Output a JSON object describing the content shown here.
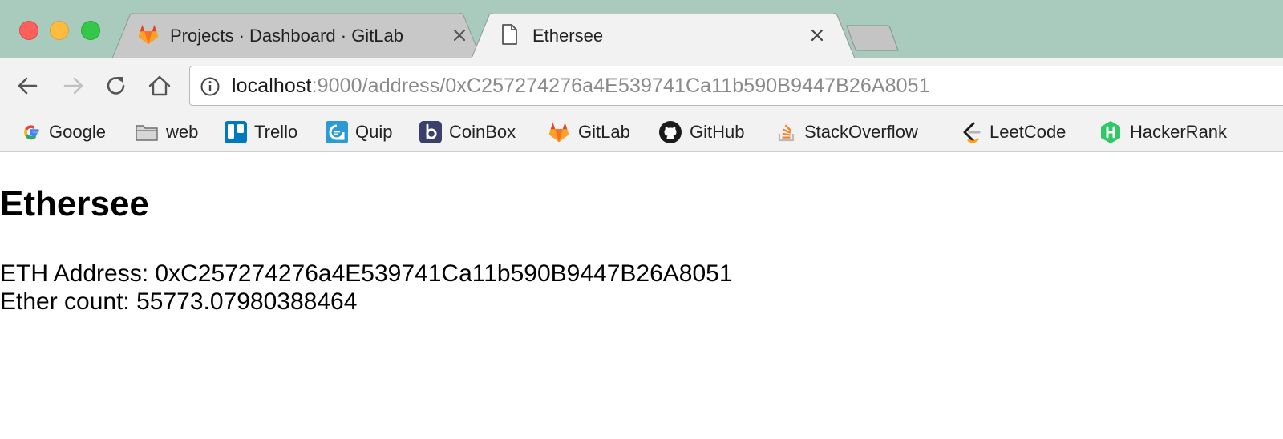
{
  "tabs": [
    {
      "title": "Projects · Dashboard · GitLab",
      "icon": "gitlab-icon",
      "active": false
    },
    {
      "title": "Ethersee",
      "icon": "document-icon",
      "active": true
    }
  ],
  "address_bar": {
    "url_host": "localhost",
    "url_rest": ":9000/address/0xC257274276a4E539741Ca11b590B9447B26A8051"
  },
  "bookmarks": [
    {
      "label": "Google",
      "icon": "google-icon"
    },
    {
      "label": "web",
      "icon": "folder-icon"
    },
    {
      "label": "Trello",
      "icon": "trello-icon"
    },
    {
      "label": "Quip",
      "icon": "quip-icon"
    },
    {
      "label": "CoinBox",
      "icon": "coinbox-icon"
    },
    {
      "label": "GitLab",
      "icon": "gitlab-icon"
    },
    {
      "label": "GitHub",
      "icon": "github-icon"
    },
    {
      "label": "StackOverflow",
      "icon": "stackoverflow-icon"
    },
    {
      "label": "LeetCode",
      "icon": "leetcode-icon"
    },
    {
      "label": "HackerRank",
      "icon": "hackerrank-icon"
    }
  ],
  "page": {
    "title": "Ethersee",
    "address_line": "ETH Address: 0xC257274276a4E539741Ca11b590B9447B26A8051",
    "ether_line": "Ether count: 55773.07980388464"
  },
  "colors": {
    "tabstrip": "#a9cbbd",
    "toolbar": "#f2f2f2",
    "url_dim": "#8a8a8a"
  }
}
